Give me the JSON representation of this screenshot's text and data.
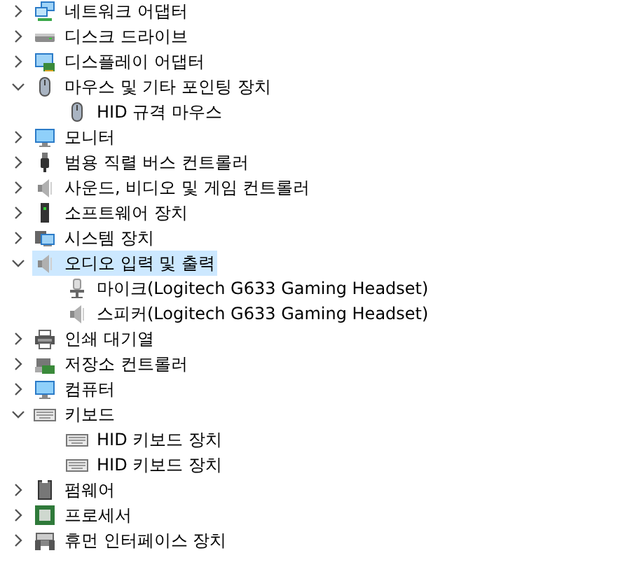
{
  "tree": [
    {
      "label": "네트워크 어댑터",
      "kind": "network",
      "expanded": false,
      "selected": false
    },
    {
      "label": "디스크 드라이브",
      "kind": "disk",
      "expanded": false,
      "selected": false
    },
    {
      "label": "디스플레이 어댑터",
      "kind": "display",
      "expanded": false,
      "selected": false
    },
    {
      "label": "마우스 및 기타 포인팅 장치",
      "kind": "mouse",
      "expanded": true,
      "selected": false,
      "children": [
        {
          "label": "HID 규격 마우스",
          "kind": "mouse",
          "selected": false
        }
      ]
    },
    {
      "label": "모니터",
      "kind": "monitor",
      "expanded": false,
      "selected": false
    },
    {
      "label": "범용 직렬 버스 컨트롤러",
      "kind": "usb",
      "expanded": false,
      "selected": false
    },
    {
      "label": "사운드, 비디오 및 게임 컨트롤러",
      "kind": "speaker",
      "expanded": false,
      "selected": false
    },
    {
      "label": "소프트웨어 장치",
      "kind": "software",
      "expanded": false,
      "selected": false
    },
    {
      "label": "시스템 장치",
      "kind": "system",
      "expanded": false,
      "selected": false
    },
    {
      "label": "오디오 입력 및 출력",
      "kind": "speaker",
      "expanded": true,
      "selected": true,
      "children": [
        {
          "label": "마이크(Logitech G633 Gaming Headset)",
          "kind": "mic",
          "selected": false
        },
        {
          "label": "스피커(Logitech G633 Gaming Headset)",
          "kind": "speaker",
          "selected": false
        }
      ]
    },
    {
      "label": "인쇄 대기열",
      "kind": "printer",
      "expanded": false,
      "selected": false
    },
    {
      "label": "저장소 컨트롤러",
      "kind": "storage",
      "expanded": false,
      "selected": false
    },
    {
      "label": "컴퓨터",
      "kind": "monitor",
      "expanded": false,
      "selected": false
    },
    {
      "label": "키보드",
      "kind": "keyboard",
      "expanded": true,
      "selected": false,
      "children": [
        {
          "label": "HID 키보드 장치",
          "kind": "keyboard",
          "selected": false
        },
        {
          "label": "HID 키보드 장치",
          "kind": "keyboard",
          "selected": false
        }
      ]
    },
    {
      "label": "펌웨어",
      "kind": "firmware",
      "expanded": false,
      "selected": false
    },
    {
      "label": "프로세서",
      "kind": "processor",
      "expanded": false,
      "selected": false
    },
    {
      "label": "휴먼 인터페이스 장치",
      "kind": "hid",
      "expanded": false,
      "selected": false
    }
  ]
}
